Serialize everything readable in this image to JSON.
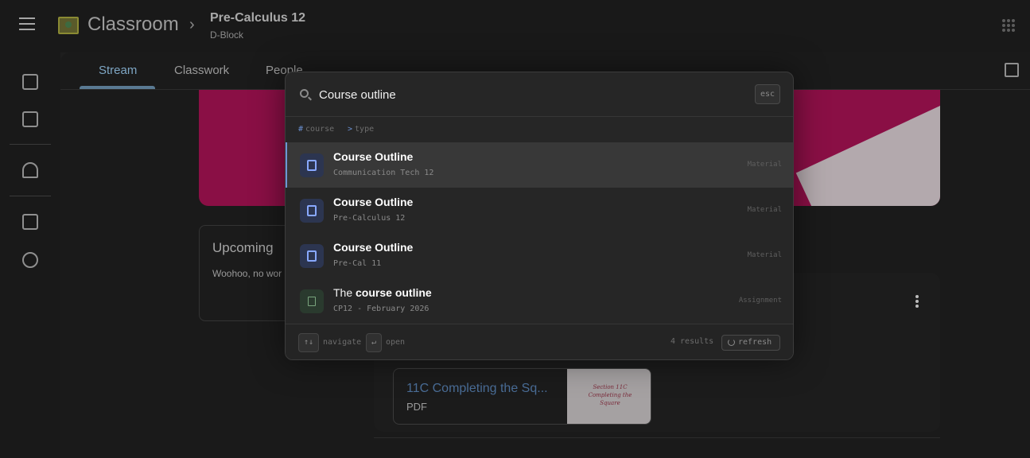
{
  "header": {
    "app_title": "Classroom",
    "course_title": "Pre-Calculus 12",
    "course_section": "D-Block"
  },
  "tabs": [
    {
      "label": "Stream",
      "active": true
    },
    {
      "label": "Classwork",
      "active": false
    },
    {
      "label": "People",
      "active": false
    }
  ],
  "sidebar": {
    "icons": [
      "home-icon",
      "calendar-icon",
      "enrolled-icon",
      "archive-icon",
      "settings-icon"
    ]
  },
  "background": {
    "upcoming_title": "Upcoming",
    "upcoming_text": "Woohoo, no wor",
    "attachment_title": "11C Completing the Sq...",
    "attachment_type": "PDF",
    "thumbnail_text": "Section 11C Completing the Square"
  },
  "palette": {
    "query": "Course outline",
    "esc_label": "esc",
    "filters": [
      {
        "symbol": "#",
        "label": "course"
      },
      {
        "symbol": ">",
        "label": "type"
      }
    ],
    "results": [
      {
        "title_prefix": "",
        "title_bold": "Course Outline",
        "subtitle": "Communication Tech 12",
        "kind": "Material",
        "icon": "material-icon",
        "selected": true
      },
      {
        "title_prefix": "",
        "title_bold": "Course Outline",
        "subtitle": "Pre-Calculus 12",
        "kind": "Material",
        "icon": "material-icon",
        "selected": false
      },
      {
        "title_prefix": "",
        "title_bold": "Course Outline",
        "subtitle": "Pre-Cal 11",
        "kind": "Material",
        "icon": "material-icon",
        "selected": false
      },
      {
        "title_prefix": "The ",
        "title_bold": "course outline",
        "subtitle": "CP12 - February 2026",
        "kind": "Assignment",
        "icon": "assignment-icon",
        "selected": false
      }
    ],
    "footer": {
      "nav_key": "↑↓",
      "nav_label": "navigate",
      "open_key": "↵",
      "open_label": "open",
      "count": "4 results",
      "refresh_label": "refresh"
    }
  },
  "colors": {
    "accent": "#6f95d6",
    "banner": "#8a0f45",
    "link": "#4a6d97"
  }
}
